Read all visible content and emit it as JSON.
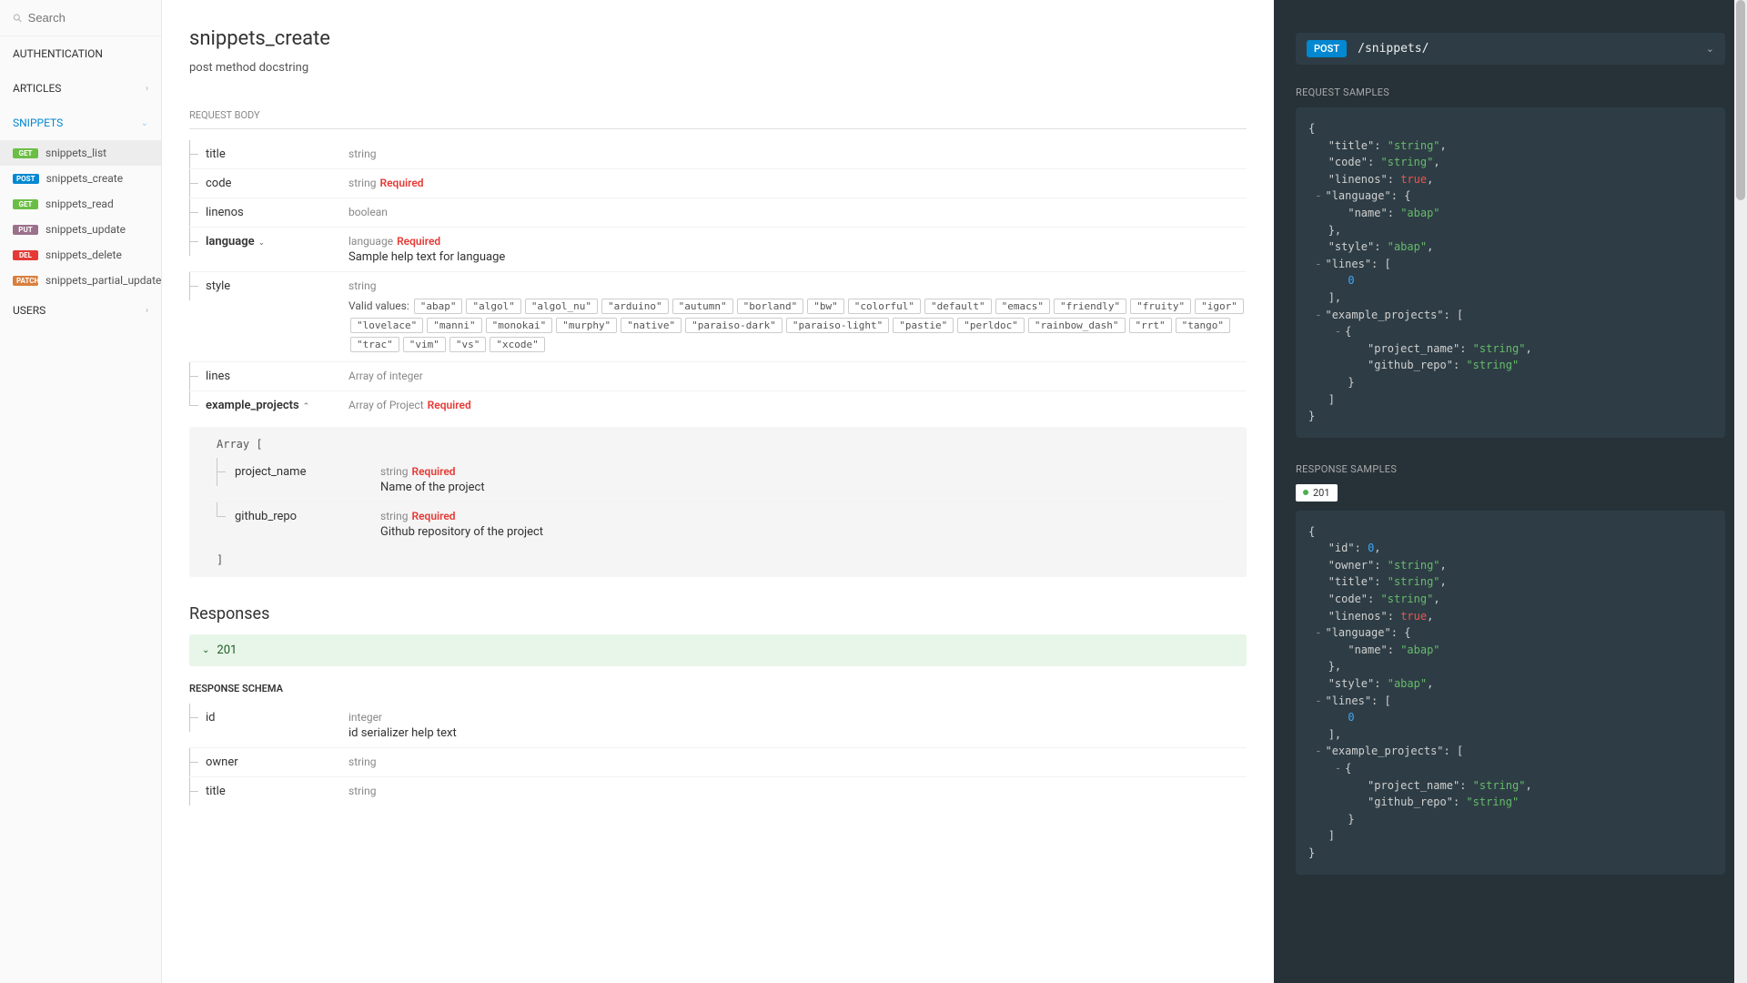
{
  "search_placeholder": "Search",
  "nav": {
    "sections": [
      {
        "label": "AUTHENTICATION",
        "expandable": false
      },
      {
        "label": "ARTICLES",
        "expandable": true
      },
      {
        "label": "SNIPPETS",
        "expandable": true,
        "active": true,
        "open": true,
        "items": [
          {
            "method": "GET",
            "label": "snippets_list",
            "active": true
          },
          {
            "method": "POST",
            "label": "snippets_create"
          },
          {
            "method": "GET",
            "label": "snippets_read"
          },
          {
            "method": "PUT",
            "label": "snippets_update"
          },
          {
            "method": "DELETE",
            "label": "snippets_delete"
          },
          {
            "method": "PATCH",
            "label": "snippets_partial_update"
          }
        ]
      },
      {
        "label": "USERS",
        "expandable": true
      }
    ]
  },
  "page": {
    "title": "snippets_create",
    "description": "post method docstring",
    "request_body_label": "REQUEST BODY",
    "responses_label": "Responses",
    "response_code": "201",
    "response_schema_label": "RESPONSE SCHEMA"
  },
  "request_body": [
    {
      "name": "title",
      "type": "string"
    },
    {
      "name": "code",
      "type": "string",
      "required": true
    },
    {
      "name": "linenos",
      "type": "boolean"
    },
    {
      "name": "language",
      "type": "language",
      "required": true,
      "bold": true,
      "expand": "down",
      "help": "Sample help text for language"
    },
    {
      "name": "style",
      "type": "string",
      "valid_label": "Valid values:",
      "valid_values": [
        "abap",
        "algol",
        "algol_nu",
        "arduino",
        "autumn",
        "borland",
        "bw",
        "colorful",
        "default",
        "emacs",
        "friendly",
        "fruity",
        "igor",
        "lovelace",
        "manni",
        "monokai",
        "murphy",
        "native",
        "paraiso-dark",
        "paraiso-light",
        "pastie",
        "perldoc",
        "rainbow_dash",
        "rrt",
        "tango",
        "trac",
        "vim",
        "vs",
        "xcode"
      ]
    },
    {
      "name": "lines",
      "type_prefix": "Array of ",
      "type": "integer"
    },
    {
      "name": "example_projects",
      "type_prefix": "Array of ",
      "type": "Project",
      "required": true,
      "bold": true,
      "expand": "up"
    }
  ],
  "nested_array": {
    "label": "Array [",
    "close": "]",
    "props": [
      {
        "name": "project_name",
        "type": "string",
        "required": true,
        "help": "Name of the project"
      },
      {
        "name": "github_repo",
        "type": "string",
        "required": true,
        "help": "Github repository of the project"
      }
    ]
  },
  "response_schema": [
    {
      "name": "id",
      "type": "integer",
      "help": "id serializer help text"
    },
    {
      "name": "owner",
      "type": "string"
    },
    {
      "name": "title",
      "type": "string"
    }
  ],
  "right": {
    "endpoint": {
      "method": "POST",
      "path": "/snippets/"
    },
    "request_samples_label": "REQUEST SAMPLES",
    "response_samples_label": "RESPONSE SAMPLES",
    "response_tab": "201",
    "request_json": {
      "title": "string",
      "code": "string",
      "linenos": true,
      "language": {
        "name": "abap"
      },
      "style": "abap",
      "lines": [
        0
      ],
      "example_projects": [
        {
          "project_name": "string",
          "github_repo": "string"
        }
      ]
    },
    "response_json": {
      "id": 0,
      "owner": "string",
      "title": "string",
      "code": "string",
      "linenos": true,
      "language": {
        "name": "abap"
      },
      "style": "abap",
      "lines": [
        0
      ],
      "example_projects": [
        {
          "project_name": "string",
          "github_repo": "string"
        }
      ]
    }
  }
}
